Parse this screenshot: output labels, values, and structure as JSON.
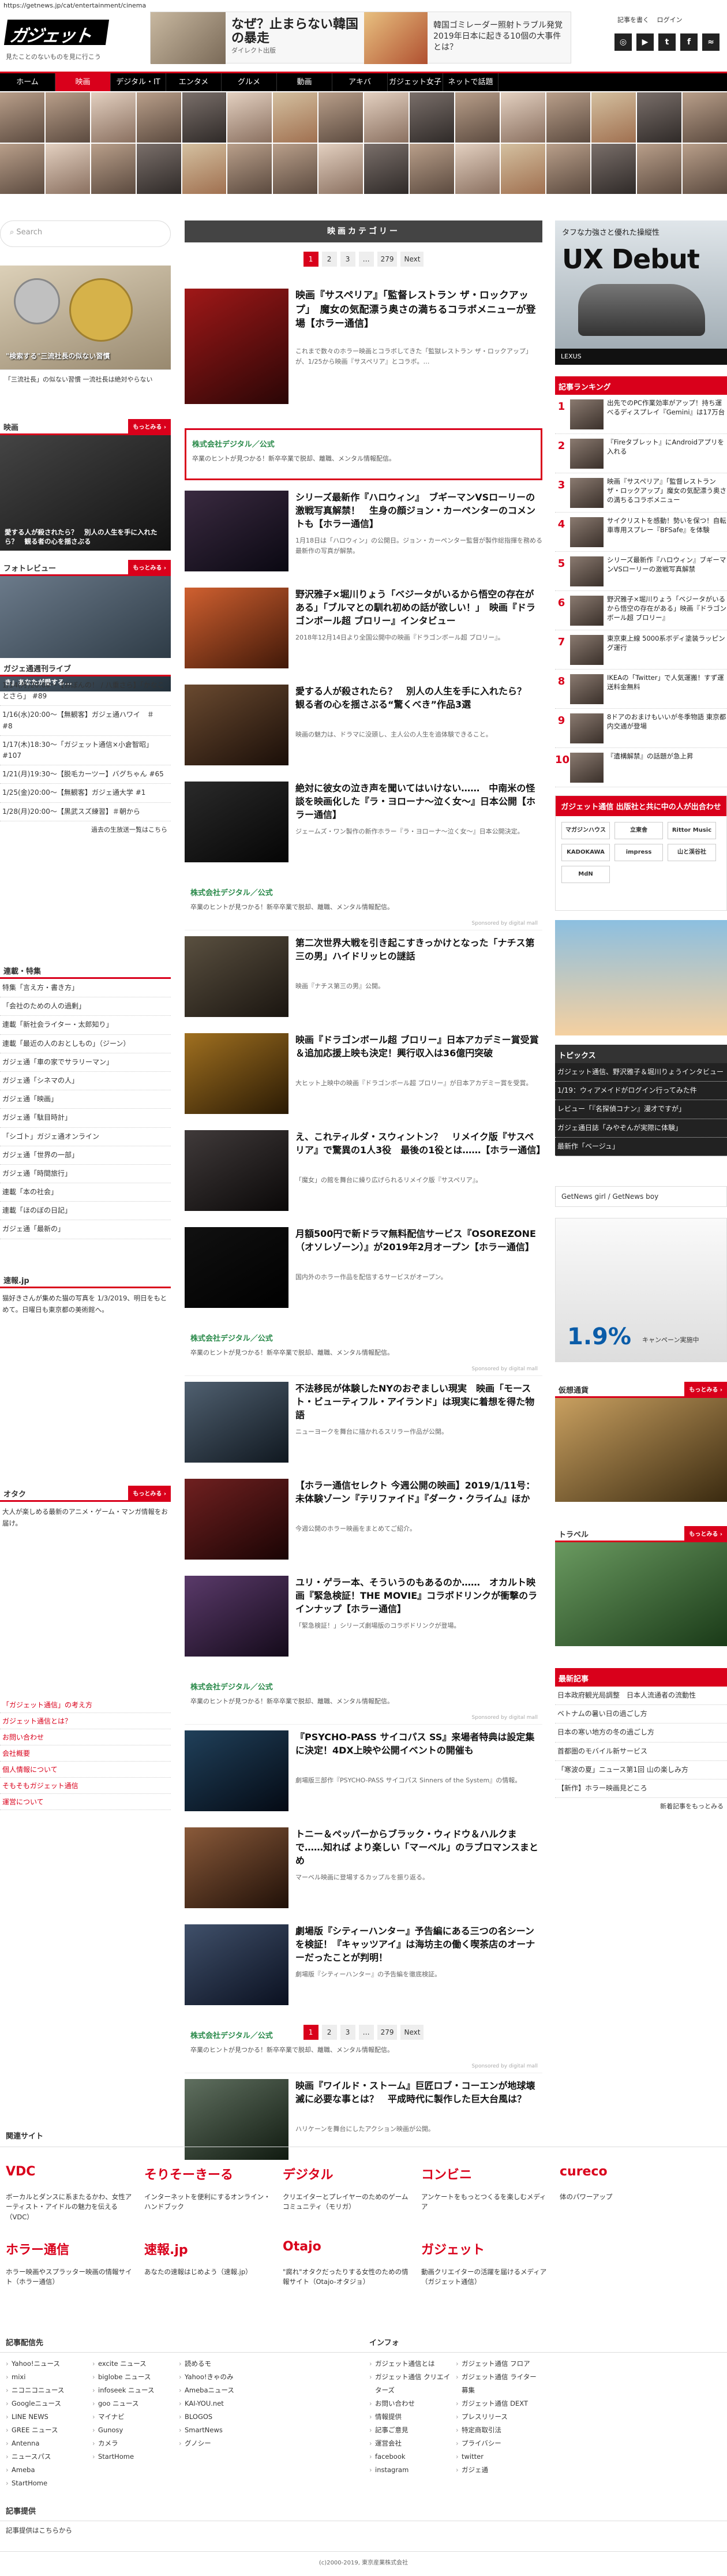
{
  "url": "https://getnews.jp/cat/entertainment/cinema",
  "header": {
    "logo": "ガジェット通信",
    "tagline": "見たことのないものを見に行こう",
    "ad": {
      "title1": "なぜ？止まらない韓国の暴走",
      "sub1": "ダイレクト出版",
      "title2": "韓国ゴミレーダー照射トラブル発覚　2019年日本に起きる10個の大事件とは？"
    },
    "links": [
      "記事を書く",
      "ログイン"
    ],
    "social": [
      "Instagram",
      "YouTube",
      "Twitter",
      "Facebook",
      "RSS"
    ]
  },
  "nav": [
    "ホーム",
    "映画",
    "デジタル・IT",
    "エンタメ",
    "グルメ",
    "動画",
    "アキバ",
    "ガジェット女子",
    "ネットで話題"
  ],
  "nav_active": "映画",
  "left": {
    "search_placeholder": "Search",
    "ad_caption": "\"検索する\"三流社長の似ない習慣",
    "ad_bar": "「三流社長」の似ない習慣 一流社長は絶対やらない",
    "eiga_head": "映画",
    "eiga_caption": "愛する人が殺されたら？　別人の人生を手に入れたら？　観る者の心を揺さぶる",
    "photo_head": "フォトレビュー",
    "photo_caption": "【本の風景】なんでもない日々です　『日々、君が好き』あなたが愛する...",
    "live_head": "ガジェ通週刊ライブ",
    "live_items": [
      "1/14(月)20:00〜【おぼんの！ / 八重さら】「かなことさら」 #89",
      "1/16(水)20:00〜【無観客】ガジェ通ハワイ　＃　#8",
      "1/17(木)18:30〜「ガジェット通信×小倉智昭」#107",
      "1/21(月)19:30〜【脱毛カーツー】バグちゃん #65",
      "1/25(金)20:00〜【無観客】ガジェ通大学 #1",
      "1/28(月)20:00〜【黒武スズ練習】＃朝から"
    ],
    "live_more": "過去の生放送一覧はこちら",
    "series_head": "連載・特集",
    "series_items": [
      "特集「言え方・書き方」",
      "「会社のための人の過剰」",
      "連載「新社会ライター・太郎知り」",
      "連載「最近の人のおとしもの」（ジーン）",
      "ガジェ通「車の家でサラリーマン」",
      "ガジェ通「シネマの人」",
      "ガジェ通「映画」",
      "ガジェ通「駄目時計」",
      "「シゴト」ガジェ通オンライン",
      "ガジェ通「世界の一部」",
      "ガジェ通「時間旅行」",
      "連載「本の社会」",
      "連載「ほのぼの日記」",
      "ガジェ通「最新の」"
    ],
    "news_head": "速報.jp",
    "news_text": "猫好きさんが集めた猫の写真を 1/3/2019、明日をもとめて。日曜日も東京都の美術館へ。",
    "otaku_head": "オタク",
    "otaku_text": "大人が楽しめる最新のアニメ・ゲーム・マンガ情報をお届け。",
    "about_links": [
      "「ガジェット通信」の考え方",
      "ガジェット通信とは？",
      "お問い合わせ",
      "会社概要",
      "個人情報について",
      "そもそもガジェット通信",
      "運営について"
    ]
  },
  "center": {
    "category_title": "映画カテゴリー",
    "pager": [
      "1",
      "2",
      "3",
      "…",
      "279",
      "Next"
    ],
    "feature": {
      "title": "映画『サスペリア』「監督レストラン ザ・ロックアップ」　魔女の気配漂う奥さの満ちるコラボメニューが登場【ホラー通信】",
      "desc": "これまで数々のホラー映画とコラボしてきた「監獄レストラン ザ・ロックアップ」が、1/25から映画『サスペリア』とコラボ。…"
    },
    "pr_title": "株式会社デジタル／公式",
    "pr_sub": "卒業のヒントが見つかる！新卒卒業で脱却、離職、メンタル情報配信。",
    "pr_by": "Sponsored by digital mall",
    "articles": [
      {
        "title": "シリーズ最新作『ハロウィン』　ブギーマンVSローリーの激戦写真解禁！　生身の顔ジョン・カーペンターのコメントも【ホラー通信】",
        "desc": "1月18日は「ハロウィン」の公開日。ジョン・カーペンター監督が製作総指揮を務める最新作の写真が解禁。"
      },
      {
        "title": "野沢雅子×堀川りょう「ベジータがいるから悟空の存在がある」「ブルマとの馴れ初めの話が欲しい！」　映画『ドラゴンボール超 ブロリー』インタビュー",
        "desc": "2018年12月14日より全国公開中の映画『ドラゴンボール超 ブロリー』。"
      },
      {
        "title": "愛する人が殺されたら？　別人の人生を手に入れたら？　観る者の心を揺さぶる“驚くべき”作品3選",
        "desc": "映画の魅力は、ドラマに没頭し、主人公の人生を追体験できること。"
      },
      {
        "title": "絶対に彼女の泣き声を聞いてはいけない……　中南米の怪談を映画化した『ラ・ヨローナ〜泣く女〜』日本公開【ホラー通信】",
        "desc": "ジェームズ・ワン製作の新作ホラー『ラ・ヨローナ〜泣く女〜』日本公開決定。"
      },
      {
        "title": "第二次世界大戦を引き起こすきっかけとなった「ナチス第三の男」ハイドリッヒの謎話",
        "desc": "映画『ナチス第三の男』公開。"
      },
      {
        "title": "映画『ドラゴンボール超 ブロリー』日本アカデミー賞受賞＆追加応援上映も決定！興行収入は36億円突破",
        "desc": "大ヒット上映中の映画『ドラゴンボール超 ブロリー』が日本アカデミー賞を受賞。"
      },
      {
        "title": "え、これティルダ・スウィントン？　リメイク版『サスペリア』で驚異の1人3役　最後の1役とは……【ホラー通信】",
        "desc": "「魔女」の館を舞台に繰り広げられるリメイク版『サスペリア』。"
      },
      {
        "title": "月額500円で新ドラマ無料配信サービス『OSOREZONE（オソレゾーン）』が2019年2月オープン【ホラー通信】",
        "desc": "国内外のホラー作品を配信するサービスがオープン。"
      },
      {
        "title": "不法移民が体験したNYのおぞましい現実　映画「モースト・ビューティフル・アイランド」は現実に着想を得た物語",
        "desc": "ニューヨークを舞台に描かれるスリラー作品が公開。"
      },
      {
        "title": "【ホラー通信セレクト 今週公開の映画】2019/1/11号：未体験ゾーン『テリファイド』『ダーク・クライム』ほか",
        "desc": "今週公開のホラー映画をまとめてご紹介。"
      },
      {
        "title": "ユリ・ゲラー本、そういうのもあるのか……　オカルト映画『緊急検証！THE MOVIE』コラボドリンクが衝撃のラインナップ【ホラー通信】",
        "desc": "「緊急検証！」シリーズ劇場版のコラボドリンクが登場。"
      },
      {
        "title": "『PSYCHO-PASS サイコパス SS』来場者特典は設定集に決定！4DX上映や公開イベントの開催も",
        "desc": "劇場版三部作『PSYCHO-PASS サイコパス Sinners of the System』の情報。"
      },
      {
        "title": "トニー＆ペッパーからブラック・ウィドウ＆ハルクまで……知れば より楽しい「マーベル」のラブロマンスまとめ",
        "desc": "マーベル映画に登場するカップルを振り返る。"
      },
      {
        "title": "劇場版『シティーハンター』予告編にある三つの名シーンを検証！『キャッツアイ』は海坊主の働く喫茶店のオーナーだったことが判明！",
        "desc": "劇場版『シティーハンター』の予告編を徹底検証。"
      },
      {
        "title": "映画『ワイルド・ストーム』巨匠ロブ・コーエンが地球壊滅に必要な事とは？　平成時代に製作した巨大台風は？",
        "desc": "ハリケーンを舞台にしたアクション映画が公開。"
      }
    ]
  },
  "right": {
    "ad_head": "タフな力強さと優れた操縦性",
    "ad_big": "UX Debut",
    "ad_brand": "LEXUS",
    "ranking_head": "記事ランキング",
    "ranking": [
      "出先でのPC作業効率がアップ！持ち運べるディスプレイ『Gemini』は17万台",
      "『Fireタブレット』にAndroidアプリを入れる",
      "映画『サスペリア』「監督レストラン ザ・ロックアップ」魔女の気配漂う奥さの満ちるコラボメニュー",
      "サイクリストを感動！勢いを保つ！自転車専用スプレー『BFSafe』を体験",
      "シリーズ最新作『ハロウィン』ブギーマンVSローリーの激戦写真解禁",
      "野沢雅子×堀川りょう「ベジータがいるから悟空の存在がある」映画『ドラゴンボール超 ブロリー』",
      "東京東上線 5000系ボディ塗装ラッピング運行",
      "IKEAの「Twitter」で人気運搬！すず運送料金無料",
      "8ドアのおまけもいいが冬季物語 東京都内交通が登場",
      "『遺構解禁』の話題が急上昇"
    ],
    "shuppan_head": "ガジェット通信 出版社と共に中の人が出合わせ",
    "publishers": [
      "マガジンハウス",
      "立東舎",
      "Rittor Music",
      "KADOKAWA",
      "impress",
      "山と渓谷社",
      "MdN"
    ],
    "topics_head": "トピックス",
    "topics": [
      "ガジェット通信、野沢雅子＆堀川りょうインタビュー",
      "1/19：ウィアメイドがログイン行ってみた件",
      "レビュー「『名探偵コナン』漫才ですが」",
      "ガジェ通日誌「みやぞんが実際に体験」",
      "最新作「ベージュ」"
    ],
    "banner": "GetNews girl / GetNews boy",
    "ad2_big": "1.9%",
    "ad2_text": "キャンペーン実施中",
    "kasotsuka_head": "仮想通貨",
    "travel_head": "トラベル",
    "news_head": "最新記事",
    "news_items": [
      "日本政府観光局調整　日本人流通者の流動性",
      "ベトナムの暑い日の過ごし方",
      "日本の寒い地方の冬の過ごし方",
      "首都圏のモバイル新サービス",
      "「寒波の夏」ニュース第1回 山の楽しみ方",
      "【新作】ホラー映画見どころ"
    ],
    "news_more": "新着記事をもっとみる"
  },
  "footer": {
    "related_head": "関連サイト",
    "services": [
      {
        "logo": "VDC",
        "desc": "ボーカルとダンスに系またるかわ、女性アーティスト・アイドルの魅力を伝える（VDC）"
      },
      {
        "logo": "そりそーきーる",
        "desc": "インターネットを便利にするオンライン・ハンドブック"
      },
      {
        "logo": "デジタル",
        "desc": "クリエイターとプレイヤーのためのゲームコミュニティ（モリガ）"
      },
      {
        "logo": "コンビニ",
        "desc": "アンケートをもっとつくるを楽しむメディア"
      },
      {
        "logo": "cureco",
        "desc": "体のパワーアップ"
      },
      {
        "logo": "ホラー通信",
        "desc": "ホラー映画やスプラッター映画の情報サイト（ホラー通信）"
      },
      {
        "logo": "速報.jp",
        "desc": "あなたの速報はじめよう（速報.jp）"
      },
      {
        "logo": "Otajo",
        "desc": "\"腐れ\"オタクだったりする女性のための情報サイト（Otajo-オタジョ）"
      },
      {
        "logo": "ガジェット",
        "desc": "動画クリエイターの活躍を届けるメディア（ガジェット通信）"
      }
    ],
    "partner_head": "記事配信先",
    "partners": [
      [
        "Yahoo!ニュース",
        "mixi",
        "ニコニコニュース",
        "Googleニュース",
        "LINE NEWS",
        "GREE ニュース",
        "Antenna",
        "ニュースパス",
        "Ameba",
        "StartHome"
      ],
      [
        "excite ニュース",
        "biglobe ニュース",
        "infoseek ニュース",
        "goo ニュース",
        "マイナビ",
        "Gunosy",
        "カメラ",
        "StartHome"
      ],
      [
        "読めるモ",
        "Yahoo!きゃのみ",
        "Amebaニュース",
        "KAI-YOU.net",
        "BLOGOS",
        "SmartNews",
        "グノシー"
      ],
      []
    ],
    "info_head": "インフォ",
    "info": [
      [
        "ガジェット通信とは",
        "ガジェット通信 クリエイターズ",
        "お問い合わせ",
        "情報提供",
        "記事ご意見",
        "運営会社",
        "facebook",
        "instagram"
      ],
      [
        "ガジェット通信 フロア",
        "ガジェット通信 ライター募集",
        "ガジェット通信 DEXT",
        "プレスリリース",
        "特定商取引法",
        "プライバシー",
        "twitter",
        "ガジェ通"
      ]
    ],
    "recruit_head": "記事提供",
    "recruit_text": "記事提供はこちらから",
    "copyright": "(c)2000-2019, 東京産業株式会社"
  }
}
